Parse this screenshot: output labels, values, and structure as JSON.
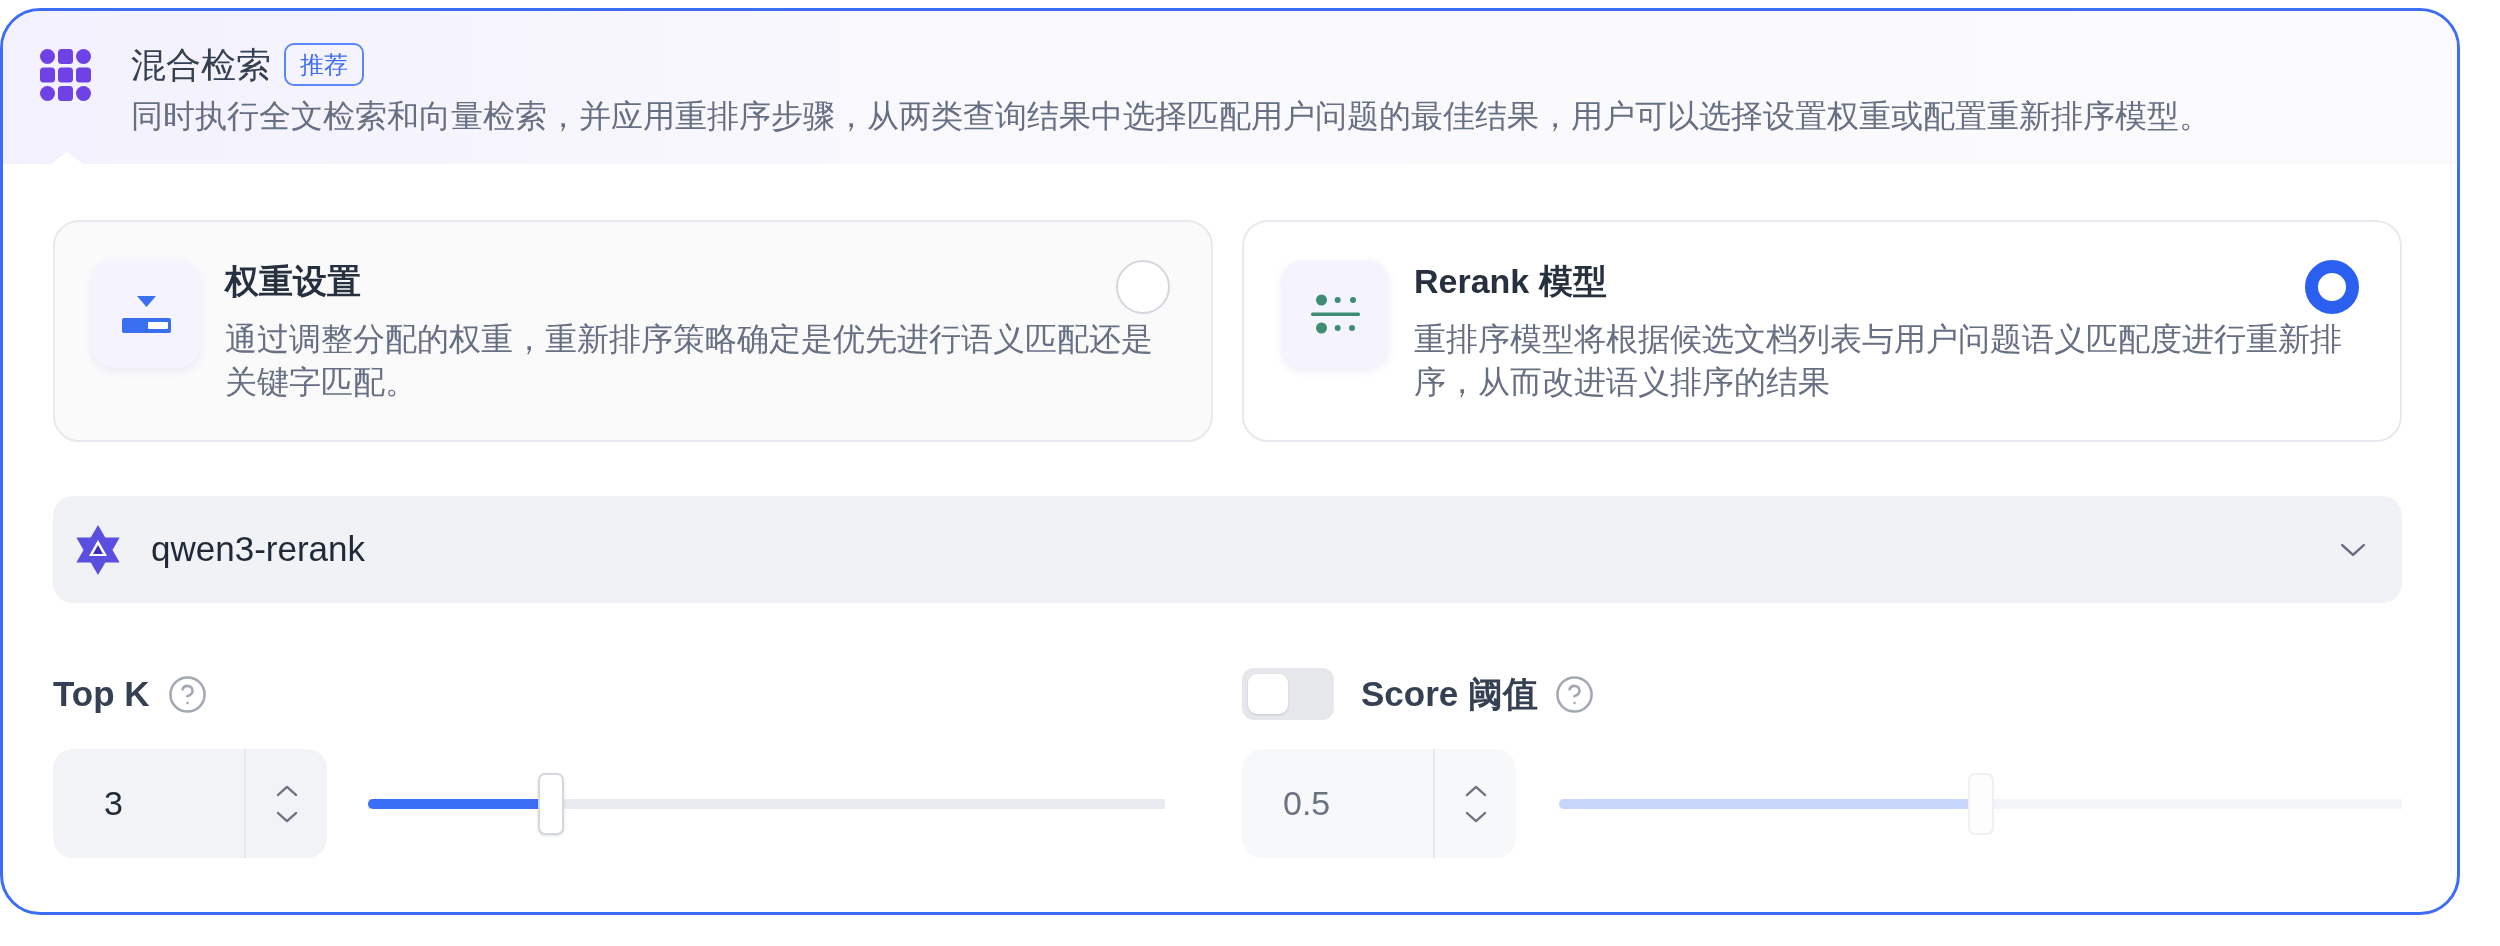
{
  "retrieval_method": {
    "selected": true,
    "title": "混合检索",
    "badge": "推荐",
    "description": "同时执行全文检索和向量检索，并应用重排序步骤，从两类查询结果中选择匹配用户问题的最佳结果，用户可以选择设置权重或配置重新排序模型。"
  },
  "options": [
    {
      "kind": "weights",
      "title": "权重设置",
      "description": "通过调整分配的权重，重新排序策略确定是优先进行语义匹配还是关键字匹配。",
      "selected": false
    },
    {
      "kind": "rerank",
      "title": "Rerank 模型",
      "description": "重排序模型将根据候选文档列表与用户问题语义匹配度进行重新排序，从而改进语义排序的结果",
      "selected": true
    }
  ],
  "model_select": {
    "value": "qwen3-rerank"
  },
  "top_k": {
    "label": "Top K",
    "value": "3",
    "level": 0.23
  },
  "score_threshold": {
    "label": "Score 阈值",
    "enabled": false,
    "value": "0.5",
    "level": 0.5
  }
}
